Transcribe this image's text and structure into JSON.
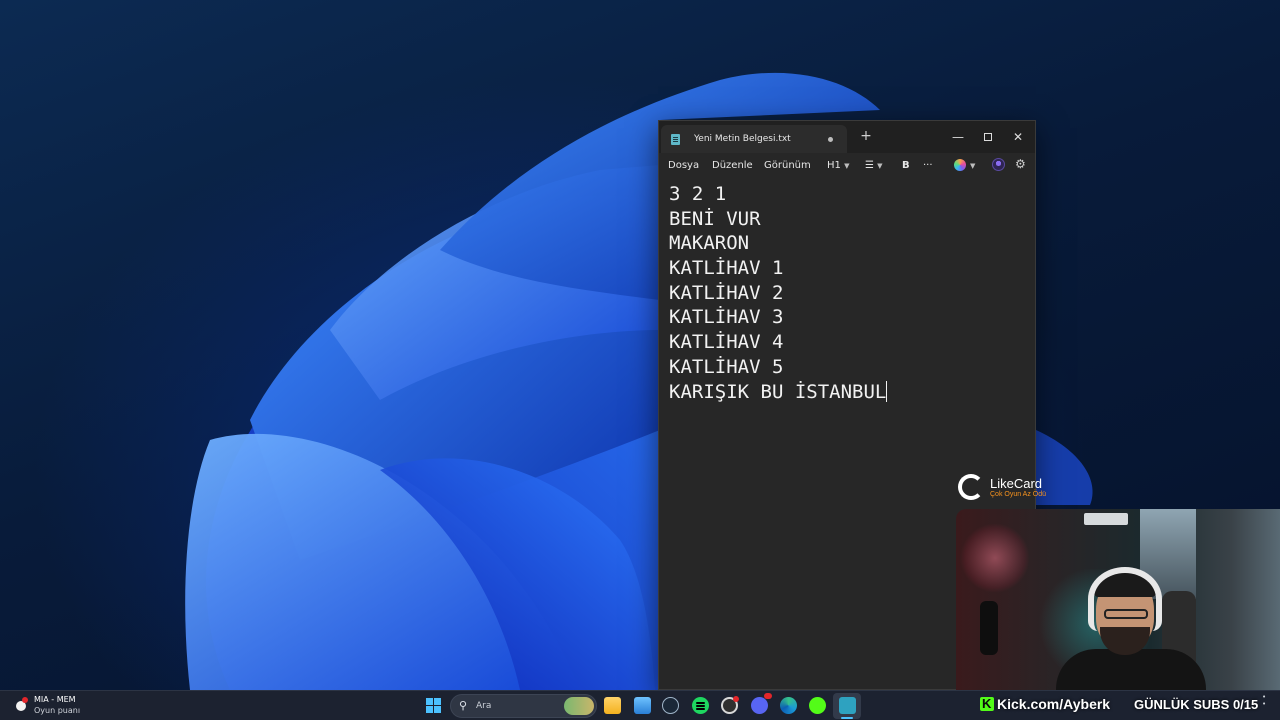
{
  "notepad": {
    "tab_title": "Yeni Metin Belgesi.txt",
    "new_tab_label": "+",
    "minimize_label": "—",
    "close_label": "✕",
    "menu": {
      "file": "Dosya",
      "edit": "Düzenle",
      "view": "Görünüm",
      "heading": "H1",
      "bold": "B",
      "more": "···"
    },
    "lines": [
      "3 2 1",
      "BENİ VUR",
      "MAKARON",
      "KATLİHAV 1",
      "KATLİHAV 2",
      "KATLİHAV 3",
      "KATLİHAV 4",
      "KATLİHAV 5",
      "KARIŞIK BU İSTANBUL"
    ]
  },
  "sponsor": {
    "name": "LikeCard",
    "tagline": "Çok Oyun Az Ödü"
  },
  "taskbar": {
    "widget_title": "MIA - MEM",
    "widget_subtitle": "Oyun puanı",
    "search_placeholder": "Ara"
  },
  "stream_overlay": {
    "kick_url": "Kick.com/Ayberk",
    "subs_goal": "GÜNLÜK SUBS 0/15"
  },
  "colors": {
    "accent": "#4cc2ff",
    "kick_green": "#53fc18",
    "notepad_bg": "#272727"
  }
}
